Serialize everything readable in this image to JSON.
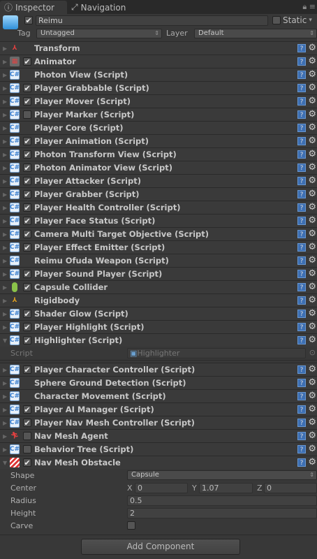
{
  "tabs": [
    {
      "label": "Inspector",
      "icon": "info-icon"
    },
    {
      "label": "Navigation",
      "icon": "navigation-icon"
    }
  ],
  "gameobject": {
    "active": true,
    "name": "Reimu",
    "static_label": "Static",
    "static": false,
    "tag_label": "Tag",
    "tag": "Untagged",
    "layer_label": "Layer",
    "layer": "Default"
  },
  "components": [
    {
      "name": "Transform",
      "icon": "transform-icon",
      "checkbox": null
    },
    {
      "name": "Animator",
      "icon": "animator-icon",
      "checkbox": true
    },
    {
      "name": "Photon View (Script)",
      "icon": "script-icon",
      "checkbox": null
    },
    {
      "name": "Player Grabbable (Script)",
      "icon": "script-icon",
      "checkbox": true
    },
    {
      "name": "Player Mover (Script)",
      "icon": "script-icon",
      "checkbox": true
    },
    {
      "name": "Player Marker (Script)",
      "icon": "script-icon",
      "checkbox": false
    },
    {
      "name": "Player Core (Script)",
      "icon": "script-icon",
      "checkbox": null
    },
    {
      "name": "Player Animation (Script)",
      "icon": "script-icon",
      "checkbox": true
    },
    {
      "name": "Photon Transform View (Script)",
      "icon": "script-icon",
      "checkbox": true
    },
    {
      "name": "Photon Animator View (Script)",
      "icon": "script-icon",
      "checkbox": true
    },
    {
      "name": "Player Attacker (Script)",
      "icon": "script-icon",
      "checkbox": true
    },
    {
      "name": "Player Grabber (Script)",
      "icon": "script-icon",
      "checkbox": true
    },
    {
      "name": "Player Health Controller (Script)",
      "icon": "script-icon",
      "checkbox": true
    },
    {
      "name": "Player Face Status (Script)",
      "icon": "script-icon",
      "checkbox": true
    },
    {
      "name": "Camera Multi Target Objective (Script)",
      "icon": "script-icon",
      "checkbox": true
    },
    {
      "name": "Player Effect Emitter (Script)",
      "icon": "script-icon",
      "checkbox": true
    },
    {
      "name": "Reimu Ofuda Weapon (Script)",
      "icon": "script-icon",
      "checkbox": null
    },
    {
      "name": "Player Sound Player (Script)",
      "icon": "script-icon",
      "checkbox": true
    },
    {
      "name": "Capsule Collider",
      "icon": "capsule-collider-icon",
      "checkbox": true
    },
    {
      "name": "Rigidbody",
      "icon": "rigidbody-icon",
      "checkbox": null
    },
    {
      "name": "Shader Glow (Script)",
      "icon": "script-icon",
      "checkbox": true
    },
    {
      "name": "Player Highlight (Script)",
      "icon": "script-icon",
      "checkbox": true
    },
    {
      "name": "Highlighter (Script)",
      "icon": "script-icon",
      "checkbox": true,
      "expanded": true
    },
    {
      "name": "Player Character Controller (Script)",
      "icon": "script-icon",
      "checkbox": true
    },
    {
      "name": "Sphere Ground Detection (Script)",
      "icon": "script-icon",
      "checkbox": null
    },
    {
      "name": "Character Movement (Script)",
      "icon": "script-icon",
      "checkbox": null
    },
    {
      "name": "Player AI Manager (Script)",
      "icon": "script-icon",
      "checkbox": true
    },
    {
      "name": "Player Nav Mesh Controller (Script)",
      "icon": "script-icon",
      "checkbox": true
    },
    {
      "name": "Nav Mesh Agent",
      "icon": "nav-mesh-agent-icon",
      "checkbox": false
    },
    {
      "name": "Behavior Tree (Script)",
      "icon": "script-icon",
      "checkbox": false
    },
    {
      "name": "Nav Mesh Obstacle",
      "icon": "nav-mesh-obstacle-icon",
      "checkbox": true,
      "expanded": true
    }
  ],
  "highlighter": {
    "script_label": "Script",
    "script_value": "Highlighter"
  },
  "obstacle": {
    "shape_label": "Shape",
    "shape": "Capsule",
    "center_label": "Center",
    "x_label": "X",
    "x": "0",
    "y_label": "Y",
    "y": "1.07",
    "z_label": "Z",
    "z": "0",
    "radius_label": "Radius",
    "radius": "0.5",
    "height_label": "Height",
    "height": "2",
    "carve_label": "Carve",
    "carve": false
  },
  "add_component": "Add Component",
  "help_glyph": "?",
  "gear_glyph": "⚙",
  "check_glyph": "✔"
}
